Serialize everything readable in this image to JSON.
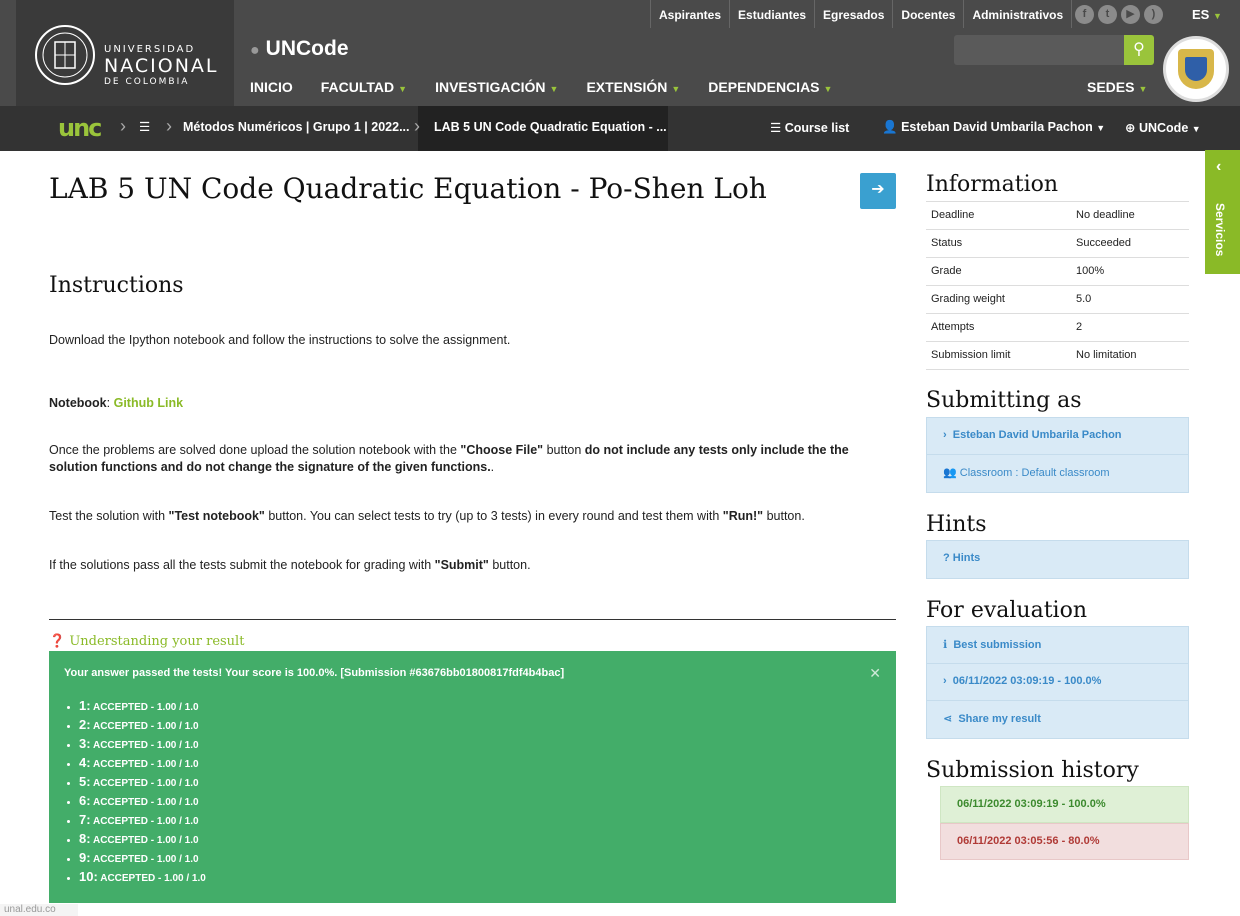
{
  "header": {
    "top_links": [
      "Aspirantes",
      "Estudiantes",
      "Egresados",
      "Docentes",
      "Administrativos"
    ],
    "language": "ES",
    "university": {
      "line1": "UNIVERSIDAD",
      "line2": "NACIONAL",
      "line3": "DE COLOMBIA"
    },
    "site_title": "UNCode",
    "nav": [
      "INICIO",
      "FACULTAD",
      "INVESTIGACIÓN",
      "EXTENSIÓN",
      "DEPENDENCIAS"
    ],
    "sedes": "SEDES",
    "search_placeholder": ""
  },
  "breadcrumb": {
    "logo": "unc",
    "course": "Métodos Numéricos | Grupo 1 | 2022...",
    "task": "LAB 5 UN Code Quadratic Equation - ...",
    "course_list": "Course list",
    "user": "Esteban David Umbarila Pachon",
    "menu": "UNCode"
  },
  "main": {
    "title": "LAB 5 UN Code Quadratic Equation - Po-Shen Loh",
    "instructions_heading": "Instructions",
    "p1": "Download the Ipython notebook and follow the instructions to solve the assignment.",
    "notebook_label": "Notebook",
    "notebook_link": "Github Link",
    "p3_a": "Once the problems are solved done upload the solution notebook with the ",
    "p3_b": "\"Choose File\"",
    "p3_c": " button ",
    "p3_d": "do not include any tests only include the the solution functions and do not change the signature of the given functions.",
    "p3_e": ".",
    "p4_a": "Test the solution with ",
    "p4_b": "\"Test notebook\"",
    "p4_c": " button. You can select tests to try (up to 3 tests) in every round and test them with ",
    "p4_d": "\"Run!\"",
    "p4_e": " button.",
    "p5_a": "If the solutions pass all the tests submit the notebook for grading with ",
    "p5_b": "\"Submit\"",
    "p5_c": " button.",
    "understanding": "Understanding your result",
    "result_message": "Your answer passed the tests! Your score is 100.0%. [Submission #63676bb01800817fdf4b4bac]",
    "results": [
      {
        "n": "1:",
        "t": "ACCEPTED - 1.00 / 1.0"
      },
      {
        "n": "2:",
        "t": "ACCEPTED - 1.00 / 1.0"
      },
      {
        "n": "3:",
        "t": "ACCEPTED - 1.00 / 1.0"
      },
      {
        "n": "4:",
        "t": "ACCEPTED - 1.00 / 1.0"
      },
      {
        "n": "5:",
        "t": "ACCEPTED - 1.00 / 1.0"
      },
      {
        "n": "6:",
        "t": "ACCEPTED - 1.00 / 1.0"
      },
      {
        "n": "7:",
        "t": "ACCEPTED - 1.00 / 1.0"
      },
      {
        "n": "8:",
        "t": "ACCEPTED - 1.00 / 1.0"
      },
      {
        "n": "9:",
        "t": "ACCEPTED - 1.00 / 1.0"
      },
      {
        "n": "10:",
        "t": "ACCEPTED - 1.00 / 1.0"
      }
    ]
  },
  "side": {
    "information": "Information",
    "info_rows": [
      {
        "k": "Deadline",
        "v": "No deadline"
      },
      {
        "k": "Status",
        "v": "Succeeded"
      },
      {
        "k": "Grade",
        "v": "100%"
      },
      {
        "k": "Grading weight",
        "v": "5.0"
      },
      {
        "k": "Attempts",
        "v": "2"
      },
      {
        "k": "Submission limit",
        "v": "No limitation"
      }
    ],
    "submitting_as": "Submitting as",
    "submitter": "Esteban David Umbarila Pachon",
    "classroom": "Classroom : Default classroom",
    "hints_heading": "Hints",
    "hints": "Hints",
    "for_evaluation": "For evaluation",
    "best_submission": "Best submission",
    "eval_entry": "06/11/2022 03:09:19 - 100.0%",
    "share": "Share my result",
    "history_heading": "Submission history",
    "history": [
      "06/11/2022 03:09:19 - 100.0%",
      "06/11/2022 03:05:56 - 80.0%"
    ]
  },
  "servicios": "Servicios",
  "footer_note": "unal.edu.co",
  "colors": {
    "accent": "#9ac43b",
    "success": "#43ad69",
    "info": "#3aa0d0"
  }
}
